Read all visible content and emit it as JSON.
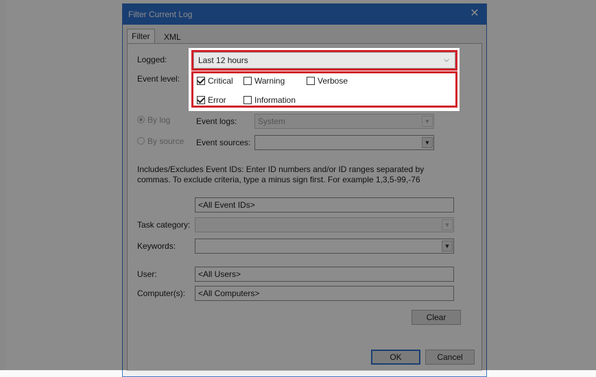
{
  "window": {
    "title": "Filter Current Log",
    "close_symbol": "✕"
  },
  "tabs": [
    {
      "label": "Filter"
    },
    {
      "label": "XML"
    }
  ],
  "logged": {
    "label": "Logged:",
    "value": "Last 12 hours"
  },
  "event_level": {
    "label": "Event level:",
    "items": [
      {
        "label": "Critical",
        "checked": true
      },
      {
        "label": "Warning",
        "checked": false
      },
      {
        "label": "Verbose",
        "checked": false
      },
      {
        "label": "Error",
        "checked": true
      },
      {
        "label": "Information",
        "checked": false
      }
    ]
  },
  "by_log": {
    "label": "By log",
    "selected": true
  },
  "by_source": {
    "label": "By source",
    "selected": false
  },
  "event_logs": {
    "label": "Event logs:",
    "value": "System"
  },
  "event_sources": {
    "label": "Event sources:",
    "value": ""
  },
  "description": "Includes/Excludes Event IDs: Enter ID numbers and/or ID ranges separated by commas. To exclude criteria, type a minus sign first. For example 1,3,5-99,-76",
  "event_ids": {
    "value": "<All Event IDs>"
  },
  "task_category": {
    "label": "Task category:",
    "value": ""
  },
  "keywords": {
    "label": "Keywords:",
    "value": ""
  },
  "user": {
    "label": "User:",
    "value": "<All Users>"
  },
  "computers": {
    "label": "Computer(s):",
    "value": "<All Computers>"
  },
  "buttons": {
    "clear": "Clear",
    "ok": "OK",
    "cancel": "Cancel"
  },
  "colors": {
    "titlebar": "#2f72d0",
    "highlight": "#d0202a"
  }
}
